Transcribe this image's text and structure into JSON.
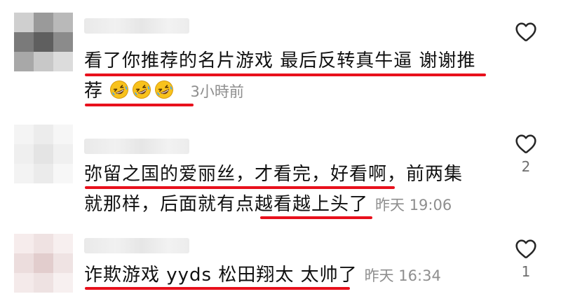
{
  "comments": [
    {
      "line1": "看了你推荐的名片游戏 最后反转真牛逼 谢谢推",
      "line2": "荐",
      "emoji_name": "rolling-on-floor-laughing-emoji",
      "emoji_count": 3,
      "time": "3小時前",
      "likes": ""
    },
    {
      "line1": "弥留之国的爱丽丝，才看完，好看啊，前两集",
      "line2": "就那样，后面就有点越看越上头了",
      "time": "昨天 19:06",
      "likes": "2"
    },
    {
      "line1": "诈欺游戏 yyds 松田翔太 太帅了",
      "time": "昨天 16:34",
      "likes": "1"
    }
  ],
  "icons": {
    "like": "heart-outline-icon",
    "emoji": "rolling-on-floor-laughing-emoji"
  },
  "colors": {
    "underline": "#e8101c",
    "text": "#111111",
    "meta": "#8e8e8e",
    "emoji_face": "#f8c21c"
  }
}
